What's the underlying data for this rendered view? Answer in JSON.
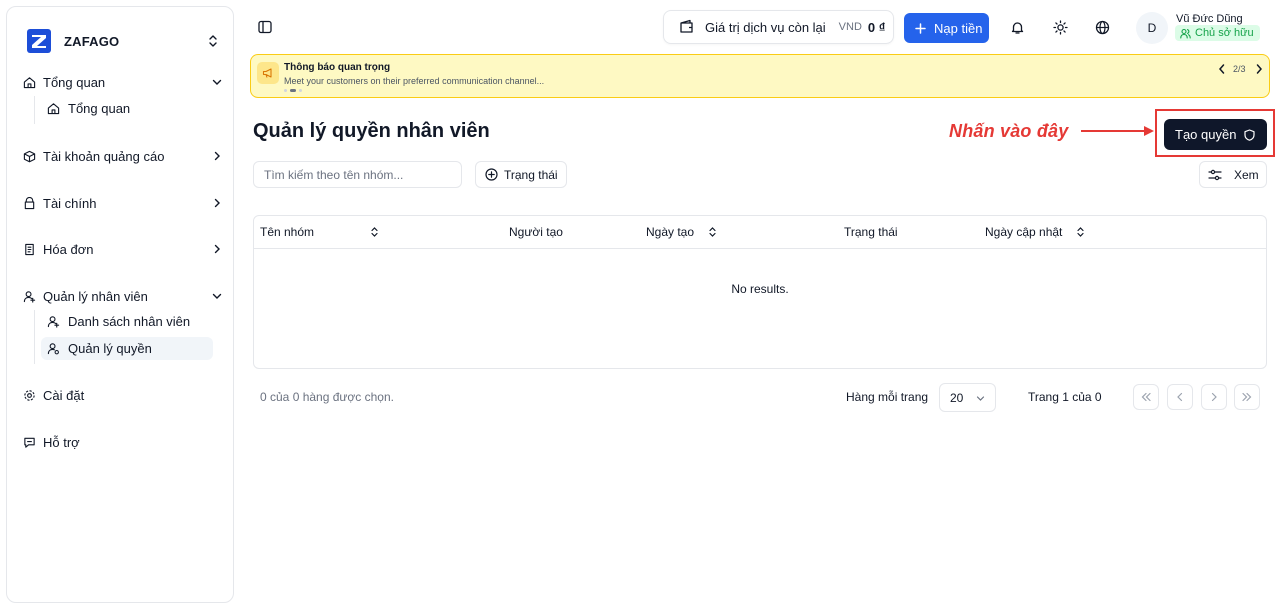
{
  "sidebar": {
    "brand": "ZAFAGO",
    "items": [
      {
        "label": "Tổng quan",
        "icon": "home-icon"
      },
      {
        "label": "Tài khoản quảng cáo",
        "icon": "box-icon"
      },
      {
        "label": "Tài chính",
        "icon": "wallet-icon"
      },
      {
        "label": "Hóa đơn",
        "icon": "receipt-icon"
      },
      {
        "label": "Quản lý nhân viên",
        "icon": "user-icon"
      },
      {
        "label": "Cài đặt",
        "icon": "gear-icon"
      },
      {
        "label": "Hỗ trợ",
        "icon": "chat-icon"
      }
    ],
    "subitems": {
      "overview": [
        "Tổng quan"
      ],
      "staff": [
        "Danh sách nhân viên",
        "Quản lý quyền"
      ]
    }
  },
  "header": {
    "balance_label": "Giá trị dịch vụ còn lại",
    "currency": "VND",
    "amount": "0 ₫",
    "topup_label": "Nạp tiền",
    "user_initial": "D",
    "user_name": "Vũ Đức Dũng",
    "user_role": "Chủ sở hữu"
  },
  "announcement": {
    "title": "Thông báo quan trọng",
    "text": "Meet your customers on their preferred communication channel...",
    "counter": "2/3"
  },
  "page": {
    "title": "Quản lý quyền nhân viên",
    "hint": "Nhấn vào đây",
    "create_label": "Tạo quyền",
    "search_placeholder": "Tìm kiếm theo tên nhóm...",
    "status_filter": "Trạng thái",
    "view_label": "Xem"
  },
  "table": {
    "columns": [
      "Tên nhóm",
      "Người tạo",
      "Ngày tạo",
      "Trạng thái",
      "Ngày cập nhật"
    ],
    "empty_text": "No results."
  },
  "pagination": {
    "selected_info": "0 của 0 hàng được chọn.",
    "rows_label": "Hàng mỗi trang",
    "rows_value": "20",
    "page_info": "Trang 1 của 0"
  },
  "colors": {
    "primary": "#2563eb",
    "dark": "#0f172a",
    "annotation": "#e53935",
    "notice_bg": "#fef9c3",
    "role_bg": "#dcfce7"
  }
}
